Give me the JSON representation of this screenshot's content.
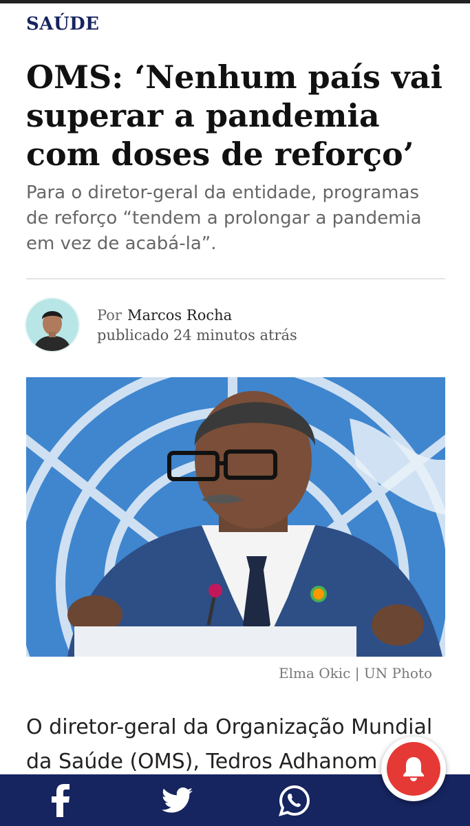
{
  "article": {
    "category": "SAÚDE",
    "headline": "OMS: ‘Nenhum país vai superar a pandemia com doses de reforço’",
    "subtitle": "Para o diretor-geral da entidade, programas de reforço “tendem a prolongar a pandemia em vez de acabá-la”.",
    "byline": {
      "by_label": "Por",
      "author": "Marcos Rocha",
      "published_label": "publicado",
      "time_ago": "24 minutos atrás"
    },
    "photo_credit": "Elma Okic | UN Photo",
    "body_start": "O diretor-geral da Organização Mundial da Saúde (OMS), Tedros Adhanom"
  },
  "share_bar": {
    "items": [
      {
        "icon": "facebook-icon"
      },
      {
        "icon": "twitter-icon"
      },
      {
        "icon": "whatsapp-icon"
      }
    ]
  },
  "notification": {
    "icon": "bell-icon"
  },
  "colors": {
    "brand_navy": "#16245f",
    "alert_red": "#e53935",
    "photo_background_blue": "#3f86cf"
  }
}
